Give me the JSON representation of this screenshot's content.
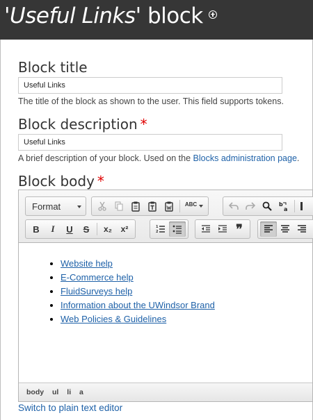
{
  "header": {
    "title_quote_open": "'",
    "title_italic": "Useful Links",
    "title_rest": "' block"
  },
  "fields": {
    "block_title": {
      "label": "Block title",
      "value": "Useful Links",
      "description": "The title of the block as shown to the user. This field supports tokens."
    },
    "block_description": {
      "label": "Block description",
      "required_mark": "*",
      "value": "Useful Links",
      "description_prefix": "A brief description of your block. Used on the ",
      "description_link": "Blocks administration page",
      "description_suffix": "."
    },
    "block_body": {
      "label": "Block body",
      "required_mark": "*"
    }
  },
  "editor": {
    "format_label": "Format",
    "toolbar_row1_icons": [
      "cut-icon",
      "copy-icon",
      "paste-icon",
      "paste-text-icon",
      "paste-word-icon",
      "spellcheck-icon",
      "undo-icon",
      "redo-icon",
      "find-icon",
      "replace-icon"
    ],
    "spellcheck_label": "ABC",
    "toolbar_row2": {
      "bold": "B",
      "italic": "I",
      "underline": "U",
      "strike": "S",
      "subscript": "x₂",
      "superscript": "x²",
      "blockquote": "❞"
    },
    "links": [
      "Website help",
      "E-Commerce help",
      "FluidSurveys help",
      "Information about the UWindsor Brand",
      "Web Policies & Guidelines"
    ],
    "path": [
      "body",
      "ul",
      "li",
      "a"
    ]
  },
  "switch_link": "Switch to plain text editor",
  "colors": {
    "header_bg": "#363636",
    "link": "#1e61a8",
    "required": "#e00000"
  }
}
